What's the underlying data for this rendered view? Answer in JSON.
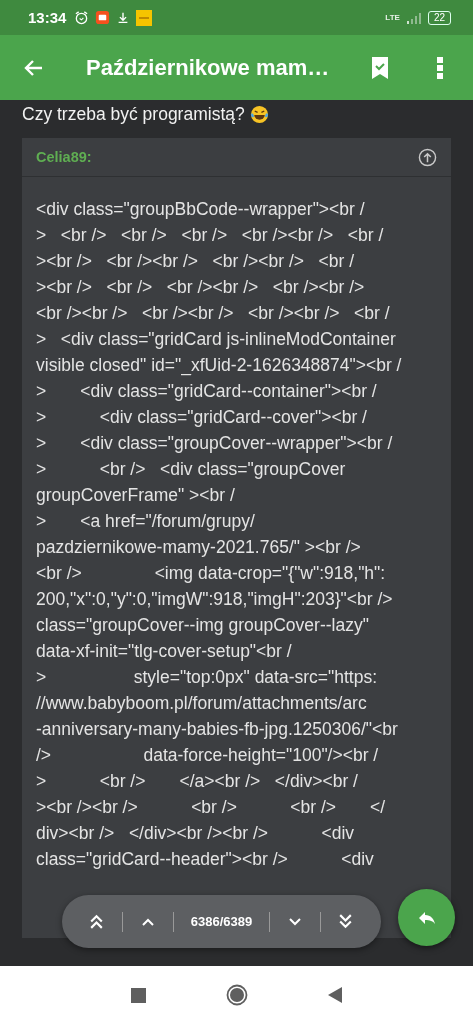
{
  "status_bar": {
    "time": "13:34",
    "network": "LTE",
    "battery": "22"
  },
  "app_bar": {
    "title": "Październikowe mam…"
  },
  "post": {
    "text": "Czy trzeba być programistą?"
  },
  "quote": {
    "author": "Celia89:",
    "lines": [
      "<div class=\"groupBbCode--wrapper\"><br /",
      ">   <br />   <br />   <br />   <br /><br />   <br /",
      "><br />   <br /><br />   <br /><br />   <br /",
      "><br />   <br />   <br /><br />   <br /><br />",
      "<br /><br />   <br /><br />   <br /><br />   <br /",
      ">   <div class=\"gridCard js-inlineModContainer",
      "visible closed\" id=\"_xfUid-2-1626348874\"><br /",
      ">       <div class=\"gridCard--container\"><br /",
      ">           <div class=\"gridCard--cover\"><br /",
      ">       <div class=\"groupCover--wrapper\"><br /",
      ">           <br />   <div class=\"groupCover",
      "groupCoverFrame\" ><br /",
      ">       <a href=\"/forum/grupy/",
      "pazdziernikowe-mamy-2021.765/\" ><br />",
      "<br />               <img data-crop=\"{\"w\":918,\"h\":",
      "200,\"x\":0,\"y\":0,\"imgW\":918,\"imgH\":203}\"<br />",
      "class=\"groupCover--img groupCover--lazy\"",
      "data-xf-init=\"tlg-cover-setup\"<br /",
      ">                  style=\"top:0px\" data-src=\"https:",
      "//www.babyboom.pl/forum/attachments/arc",
      "-anniversary-many-babies-fb-jpg.1250306/\"<br",
      "/>                   data-force-height=\"100\"/><br /",
      ">           <br />       </a><br />   </div><br /",
      "><br /><br />           <br />           <br />       </",
      "div><br />   </div><br /><br />           <div",
      "class=\"gridCard--header\"><br />           <div"
    ]
  },
  "pager": {
    "position": "6386/6389"
  }
}
